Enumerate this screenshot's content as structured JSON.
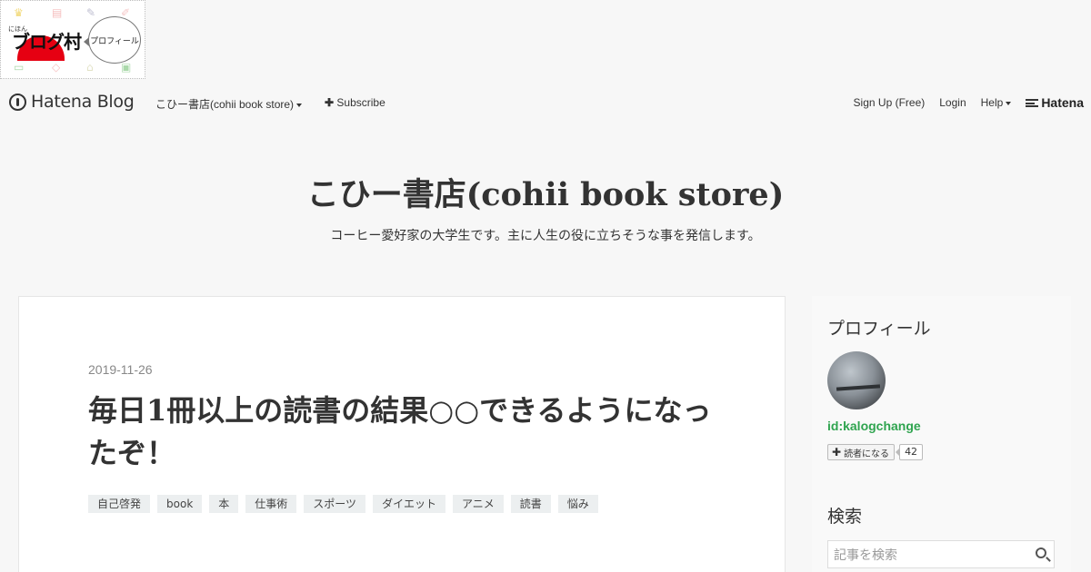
{
  "banner": {
    "small_text": "にほん",
    "logo": "ブログ村",
    "bubble": "プロフィール"
  },
  "global_header": {
    "brand": "Hatena Blog",
    "blog_menu": "こひー書店(cohii book store)",
    "subscribe": "Subscribe",
    "sign_up": "Sign Up (Free)",
    "login": "Login",
    "help": "Help",
    "hatena": "Hatena"
  },
  "blog": {
    "title": "こひー書店(cohii book store)",
    "description": "コーヒー愛好家の大学生です。主に人生の役に立ちそうな事を発信します。"
  },
  "article": {
    "date": "2019-11-26",
    "title": "毎日1冊以上の読書の結果○○できるようになったぞ！",
    "categories": [
      "自己啓発",
      "book",
      "本",
      "仕事術",
      "スポーツ",
      "ダイエット",
      "アニメ",
      "読書",
      "悩み"
    ]
  },
  "sidebar": {
    "profile_heading": "プロフィール",
    "user_id": "id:kalogchange",
    "subscribe_label": "読者になる",
    "subscriber_count": "42",
    "search_heading": "検索",
    "search_placeholder": "記事を検索"
  }
}
